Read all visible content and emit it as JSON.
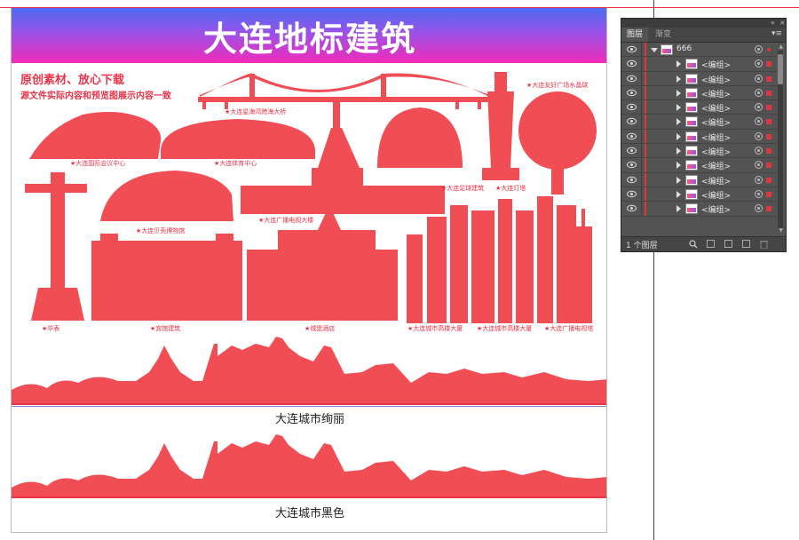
{
  "artboard": {
    "title": "大连地标建筑",
    "promo_line1": "原创素材、放心下载",
    "promo_line2": "源文件实际内容和预览图展示内容一致",
    "band1_label": "大连城市绚丽",
    "band2_label": "大连城市黑色",
    "captions": {
      "bridge": "★大连星海湾跨海大桥",
      "intl_conference": "★大连国际会议中心",
      "stadium": "★大连体育中心",
      "football": "★大连足球建筑",
      "lighthouse": "★大连灯塔",
      "crystal_ball": "★大连友好广场水晶球",
      "broadcast_building": "★大连广播电视大楼",
      "shell_museum": "★大连贝壳博物馆",
      "huabiao": "★华表",
      "binguan": "★宾馆建筑",
      "castle_hotel": "★城堡酒店",
      "towers1": "★大连城市高楼大厦",
      "towers2": "★大连城市高楼大厦",
      "tv_tower": "★大连广播电视塔"
    },
    "colors": {
      "silhouette": "#f04d55",
      "gradient_top": "#4a6cf2",
      "gradient_bottom": "#f22bb8"
    }
  },
  "layers_panel": {
    "tabs": [
      "图层",
      "渐变"
    ],
    "top_layer": "666",
    "sublayers": [
      "<编组>",
      "<编组>",
      "<编组>",
      "<编组>",
      "<编组>",
      "<编组>",
      "<编组>",
      "<编组>",
      "<编组>",
      "<编组>",
      "<编组>"
    ],
    "footer_count": "1 个图层",
    "layer_color": "#e0343f"
  }
}
